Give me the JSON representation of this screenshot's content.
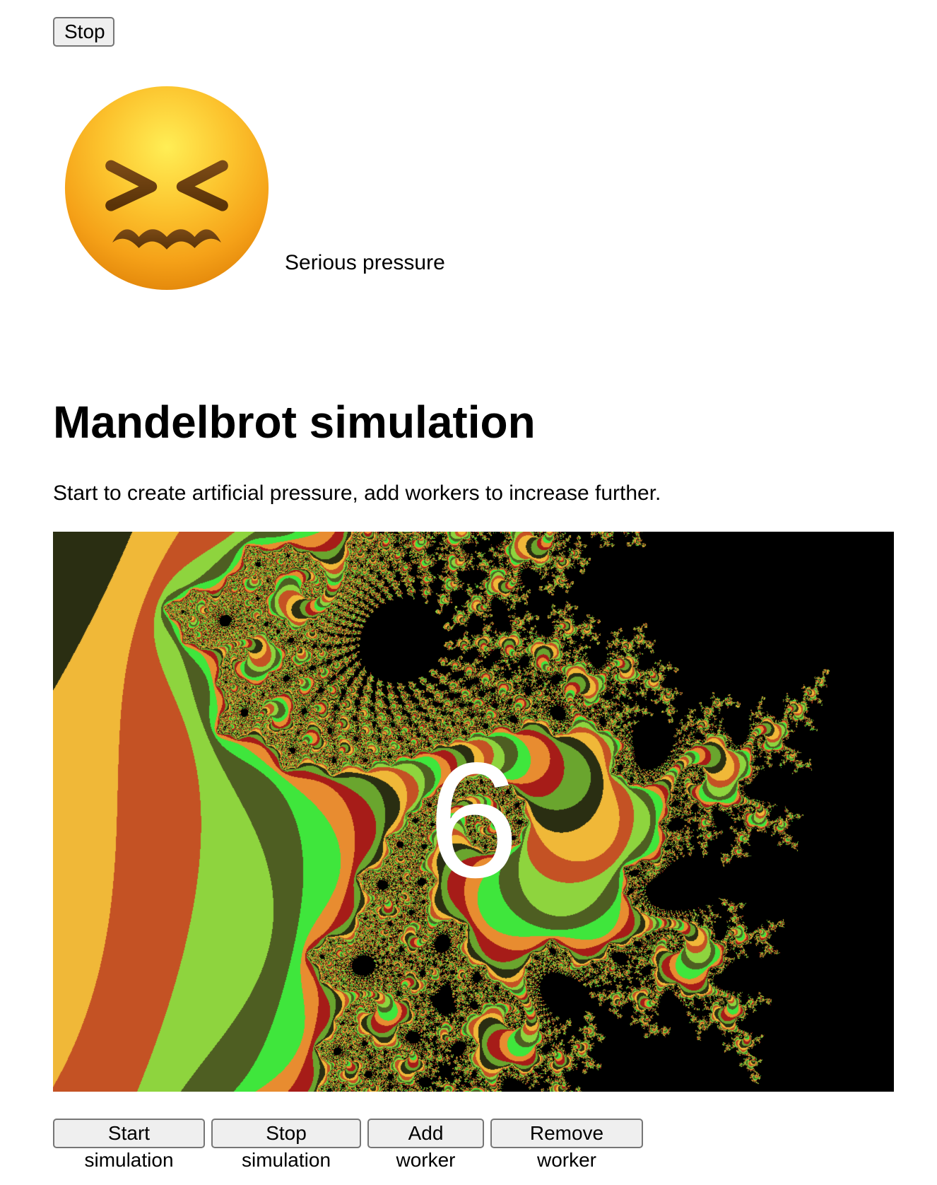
{
  "top_bar": {
    "stop_label": "Stop"
  },
  "pressure": {
    "icon": "confounded-face-icon",
    "status": "Serious pressure"
  },
  "main": {
    "title": "Mandelbrot simulation",
    "description": "Start to create artificial pressure, add workers to increase further."
  },
  "simulation": {
    "countdown": "6",
    "palette": [
      "#2a2e12",
      "#f0b838",
      "#c45224",
      "#8ed43e",
      "#4e5e22",
      "#3fe63c",
      "#e88c30",
      "#a61c18",
      "#6aa52e"
    ]
  },
  "controls": {
    "start_label": "Start simulation",
    "stop_label": "Stop simulation",
    "add_label": "Add worker",
    "remove_label": "Remove worker"
  }
}
